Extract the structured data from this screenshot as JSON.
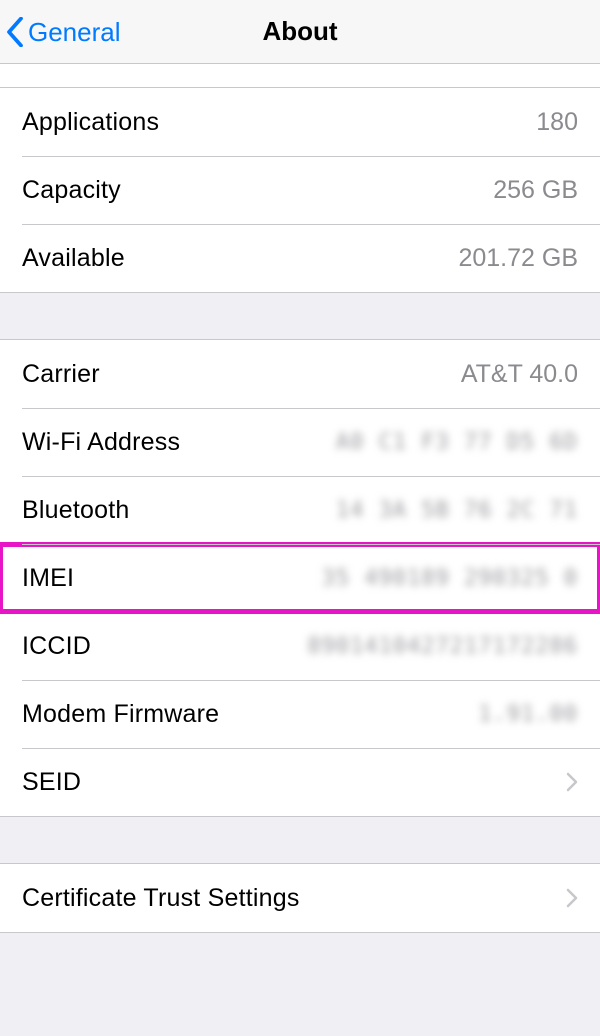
{
  "navbar": {
    "back_label": "General",
    "title": "About"
  },
  "section1": {
    "rows": [
      {
        "label": "Applications",
        "value": "180"
      },
      {
        "label": "Capacity",
        "value": "256 GB"
      },
      {
        "label": "Available",
        "value": "201.72 GB"
      }
    ]
  },
  "section2": {
    "rows": [
      {
        "label": "Carrier",
        "value": "AT&T 40.0",
        "blurred": false
      },
      {
        "label": "Wi-Fi Address",
        "value": "A0 C1 F3 77 D5 6D",
        "blurred": true
      },
      {
        "label": "Bluetooth",
        "value": "14 3A 5B 76 2C 71",
        "blurred": true
      },
      {
        "label": "IMEI",
        "value": "35 490189 290325 0",
        "blurred": true,
        "highlight": true
      },
      {
        "label": "ICCID",
        "value": "8901410427217172286",
        "blurred": true
      },
      {
        "label": "Modem Firmware",
        "value": "1.91.00",
        "blurred": true
      },
      {
        "label": "SEID",
        "value": "",
        "chevron": true
      }
    ]
  },
  "section3": {
    "rows": [
      {
        "label": "Certificate Trust Settings",
        "value": "",
        "chevron": true
      }
    ]
  }
}
